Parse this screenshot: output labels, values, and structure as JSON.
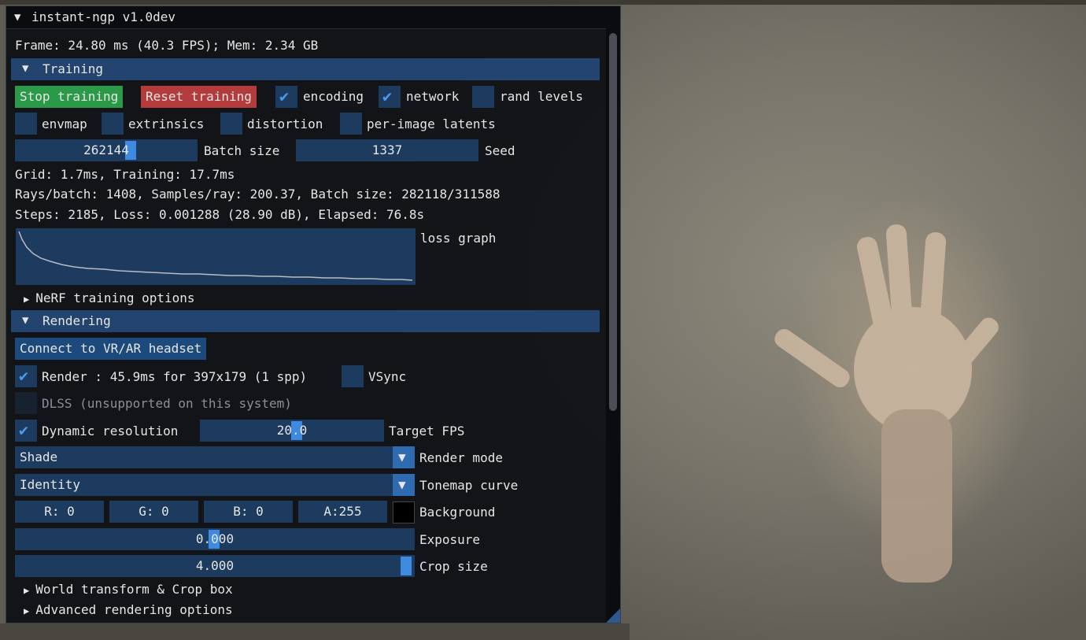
{
  "window": {
    "title": "instant-ngp v1.0dev"
  },
  "stats": {
    "frame": "Frame: 24.80 ms (40.3 FPS); Mem: 2.34 GB",
    "grid": "Grid: 1.7ms, Training: 17.7ms",
    "rays": "Rays/batch: 1408, Samples/ray: 200.37, Batch size: 282118/311588",
    "steps": "Steps: 2185, Loss: 0.001288 (28.90 dB), Elapsed: 76.8s"
  },
  "training": {
    "header": "Training",
    "stop_label": "Stop training",
    "reset_label": "Reset training",
    "encoding_label": "encoding",
    "encoding_checked": true,
    "network_label": "network",
    "network_checked": true,
    "rand_levels_label": "rand levels",
    "rand_levels_checked": false,
    "envmap_label": "envmap",
    "extrinsics_label": "extrinsics",
    "distortion_label": "distortion",
    "latents_label": "per-image latents",
    "batch_value": "262144",
    "batch_label": "Batch size",
    "seed_value": "1337",
    "seed_label": "Seed",
    "loss_graph_label": "loss graph",
    "nerf_options": "NeRF training options"
  },
  "rendering": {
    "header": "Rendering",
    "vr_button": "Connect to VR/AR headset",
    "render_label": "Render : 45.9ms for 397x179 (1 spp)",
    "render_checked": true,
    "vsync_label": "VSync",
    "dlss_label": "DLSS (unsupported on this system)",
    "dynres_label": "Dynamic resolution",
    "dynres_checked": true,
    "target_fps_value": "20.0",
    "target_fps_label": "Target FPS",
    "render_mode_value": "Shade",
    "render_mode_label": "Render mode",
    "tonemap_value": "Identity",
    "tonemap_label": "Tonemap curve",
    "bg_r": "R:  0",
    "bg_g": "G:  0",
    "bg_b": "B:  0",
    "bg_a": "A:255",
    "background_label": "Background",
    "background_color": "#000000",
    "exposure_value": "0.000",
    "exposure_label": "Exposure",
    "crop_value": "4.000",
    "crop_label": "Crop size",
    "world_transform": "World transform & Crop box",
    "advanced": "Advanced rendering options"
  },
  "colors": {
    "header": "#244470",
    "frame_bg": "#1d3a5f",
    "check": "#4a9bef",
    "stop": "#2a9a48",
    "reset": "#b43b3b"
  }
}
